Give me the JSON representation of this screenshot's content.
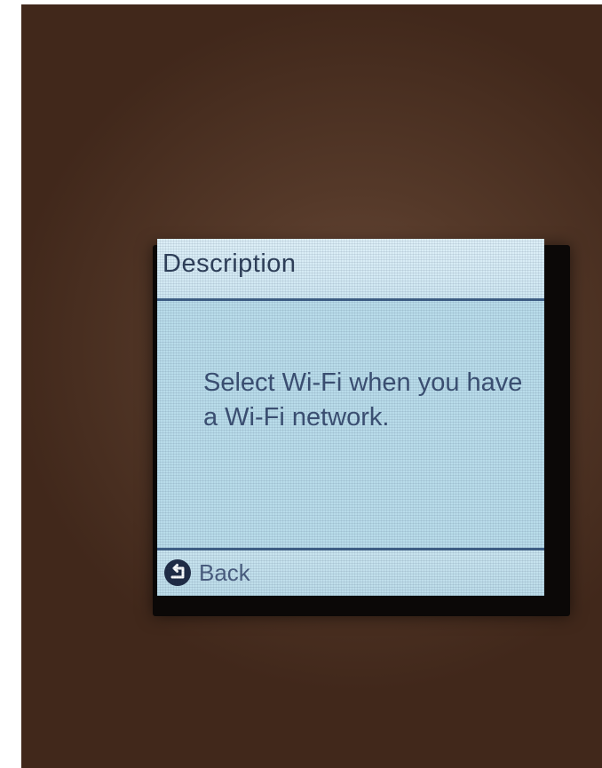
{
  "screen": {
    "title": "Description",
    "message": "Select Wi-Fi when you have a Wi-Fi network.",
    "footer": {
      "back_label": "Back",
      "back_icon": "back-arrow-icon"
    }
  },
  "colors": {
    "lcd_background": "#b9dcea",
    "divider": "#3f5f86",
    "text": "#3b4f72",
    "bezel": "#0b0807",
    "surround": "#553929"
  }
}
